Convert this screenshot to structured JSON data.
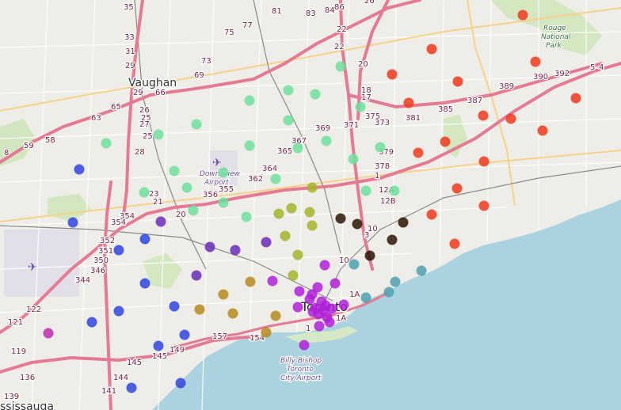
{
  "map": {
    "place_labels": {
      "vaughan": "Vaughan",
      "toronto": "Toronto",
      "mississauga": "ssissauga",
      "downsview": "Downsview",
      "downsview_airport": "Airport",
      "billy1": "Billy Bishop",
      "billy2": "Toronto",
      "billy3": "City Airport",
      "rouge1": "Rouge",
      "rouge2": "National",
      "rouge3": "Park"
    },
    "route_labels": [
      "35",
      "33",
      "31",
      "29",
      "29",
      "25",
      "25",
      "28",
      "27",
      "26",
      "23",
      "21",
      "20",
      "59",
      "58",
      "63",
      "65",
      "66",
      "69",
      "73",
      "75",
      "77",
      "81",
      "83",
      "84",
      "86",
      "26",
      "22",
      "22",
      "20",
      "18",
      "17",
      "375",
      "373",
      "371",
      "369",
      "367",
      "365",
      "364",
      "362",
      "355",
      "356",
      "354",
      "354",
      "352",
      "351",
      "350",
      "346",
      "344",
      "122",
      "121",
      "119",
      "136",
      "139",
      "141",
      "144",
      "145",
      "145",
      "149",
      "157",
      "154",
      "1",
      "1A",
      "1A",
      "3",
      "10",
      "10",
      "12A",
      "12B",
      "1",
      "378",
      "379",
      "381",
      "385",
      "387",
      "389",
      "390",
      "392",
      "5",
      "4",
      "8"
    ],
    "marker_colors": {
      "cluster_red": "#f03a1d",
      "cluster_green": "#6fe09c",
      "cluster_blue": "#2f44e0",
      "cluster_violet": "#6a2bb8",
      "cluster_olive": "#a6b42a",
      "cluster_gold": "#b68a1e",
      "cluster_brown": "#2b1505",
      "cluster_teal": "#4fa0b0",
      "cluster_purple": "#b020d8",
      "cluster_magenta": "#c02ab0"
    },
    "marker_count": 107
  }
}
